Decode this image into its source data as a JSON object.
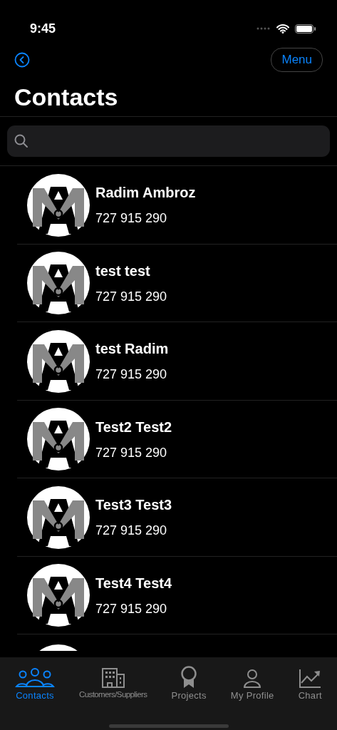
{
  "status_bar": {
    "time": "9:45"
  },
  "nav": {
    "menu_label": "Menu"
  },
  "title": "Contacts",
  "contacts": [
    {
      "kind": "contact",
      "name": "Radim Ambroz",
      "phone": "727 915 290"
    },
    {
      "kind": "contact",
      "name": "test test",
      "phone": "727 915 290"
    },
    {
      "kind": "contact",
      "name": "test Radim",
      "phone": "727 915 290"
    },
    {
      "kind": "contact",
      "name": "Test2 Test2",
      "phone": "727 915 290"
    },
    {
      "kind": "contact",
      "name": "Test3 Test3",
      "phone": "727 915 290"
    },
    {
      "kind": "contact",
      "name": "Test4 Test4",
      "phone": "727 915 290"
    },
    {
      "kind": "partial"
    }
  ],
  "tabs": [
    {
      "kind": "people",
      "label": "Contacts",
      "selected": true
    },
    {
      "kind": "building",
      "label": "Customers/Suppliers",
      "selected": false
    },
    {
      "kind": "award",
      "label": "Projects",
      "selected": false
    },
    {
      "kind": "person",
      "label": "My Profile",
      "selected": false
    },
    {
      "kind": "chart",
      "label": "Chart",
      "selected": false
    }
  ]
}
